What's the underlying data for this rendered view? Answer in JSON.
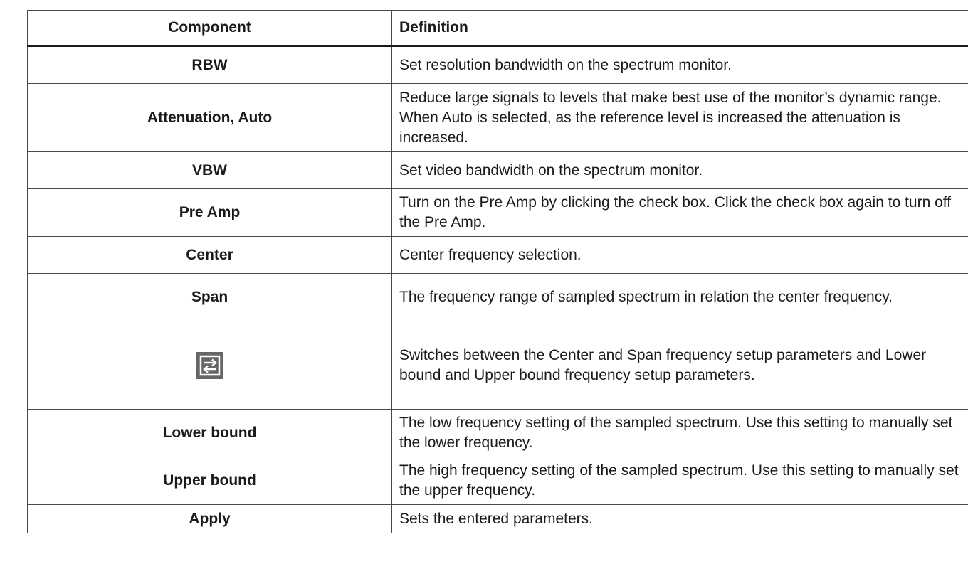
{
  "table": {
    "headers": {
      "component": "Component",
      "definition": "Definition"
    },
    "rows": [
      {
        "component": "RBW",
        "definition": "Set resolution bandwidth on the spectrum monitor."
      },
      {
        "component": "Attenuation, Auto",
        "definition": "Reduce large signals to levels that make best use of the monitor’s dynamic range. When Auto is selected, as the reference level is increased the attenuation is increased."
      },
      {
        "component": "VBW",
        "definition": "Set video bandwidth on the spectrum monitor."
      },
      {
        "component": "Pre Amp",
        "definition": "Turn on the Pre Amp by clicking the check box. Click the check box again to turn off the Pre Amp."
      },
      {
        "component": "Center",
        "definition": "Center frequency selection."
      },
      {
        "component": "Span",
        "definition": "The frequency range of sampled spectrum in relation the center frequency."
      },
      {
        "component_icon": "swap-arrows-icon",
        "definition": "Switches between the Center and Span frequency setup parameters and Lower bound and Upper bound frequency setup parameters."
      },
      {
        "component": "Lower bound",
        "definition": "The low frequency setting of the sampled spectrum. Use this setting to manually set the lower frequency."
      },
      {
        "component": "Upper bound",
        "definition": "The high frequency setting of the sampled spectrum. Use this setting to manually set the upper frequency."
      },
      {
        "component": "Apply",
        "definition": "Sets the entered parameters."
      }
    ]
  },
  "colors": {
    "icon_background": "#666666",
    "icon_foreground": "#ffffff"
  }
}
